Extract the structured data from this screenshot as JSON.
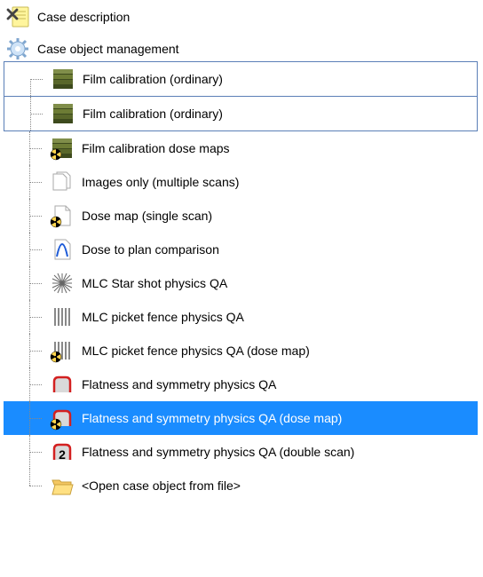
{
  "root": {
    "case_description": "Case description",
    "case_object_management": "Case object management"
  },
  "items": [
    {
      "label": "Film calibration (ordinary)"
    },
    {
      "label": "Film calibration (ordinary)"
    },
    {
      "label": "Film calibration dose maps"
    },
    {
      "label": "Images only (multiple scans)"
    },
    {
      "label": "Dose map (single scan)"
    },
    {
      "label": "Dose to plan comparison"
    },
    {
      "label": "MLC Star shot physics QA"
    },
    {
      "label": "MLC picket fence physics QA"
    },
    {
      "label": "MLC picket fence physics QA (dose map)"
    },
    {
      "label": "Flatness and symmetry physics QA"
    },
    {
      "label": "Flatness and symmetry physics QA (dose map)"
    },
    {
      "label": "Flatness and symmetry physics QA (double scan)"
    },
    {
      "label": "<Open case object from file>"
    }
  ],
  "selected_index": 10
}
